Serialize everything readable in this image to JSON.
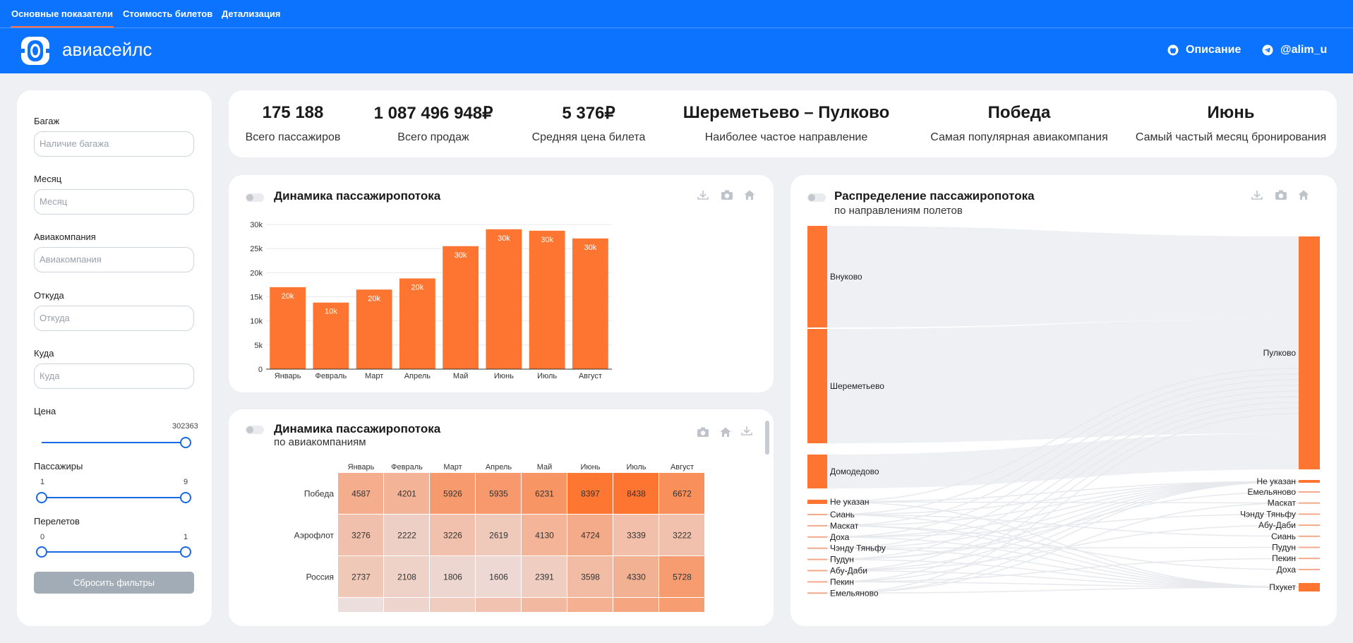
{
  "tabs": [
    "Основные показатели",
    "Стоимость билетов",
    "Детализация"
  ],
  "brand": "авиасейлс",
  "header_links": {
    "description": "Описание",
    "user": "@alim_u"
  },
  "filters": {
    "baggage_label": "Багаж",
    "baggage_placeholder": "Наличие багажа",
    "month_label": "Месяц",
    "month_placeholder": "Месяц",
    "airline_label": "Авиакомпания",
    "airline_placeholder": "Авиакомпания",
    "from_label": "Откуда",
    "from_placeholder": "Откуда",
    "to_label": "Куда",
    "to_placeholder": "Куда",
    "price_label": "Цена",
    "price_max": "302363",
    "passengers_label": "Пассажиры",
    "passengers_min": "1",
    "passengers_max": "9",
    "flights_label": "Перелетов",
    "flights_min": "0",
    "flights_max": "1",
    "reset_label": "Сбросить фильтры"
  },
  "kpis": [
    {
      "value": "175 188",
      "label": "Всего пассажиров"
    },
    {
      "value": "1 087 496 948₽",
      "label": "Всего продаж"
    },
    {
      "value": "5 376₽",
      "label": "Средняя цена билета"
    },
    {
      "value": "Шереметьево – Пулково",
      "label": "Наиболее частое направление"
    },
    {
      "value": "Победа",
      "label": "Самая популярная авиакомпания"
    },
    {
      "value": "Июнь",
      "label": "Самый частый месяц бронирования"
    }
  ],
  "bar_card": {
    "title": "Динамика пассажиропотока"
  },
  "heat_card": {
    "title": "Динамика пассажиропотока",
    "subtitle": "по авиакомпаниям"
  },
  "sankey_card": {
    "title": "Распределение пассажиропотока",
    "subtitle": "по направлениям полетов"
  },
  "chart_data": [
    {
      "type": "bar",
      "categories": [
        "Январь",
        "Февраль",
        "Март",
        "Апрель",
        "Май",
        "Июнь",
        "Июль",
        "Август"
      ],
      "values": [
        17000,
        13800,
        16500,
        18800,
        25500,
        29000,
        28700,
        27100
      ],
      "data_labels": [
        "20k",
        "10k",
        "20k",
        "20k",
        "30k",
        "30k",
        "30k",
        "30k"
      ],
      "y_ticks": [
        "0",
        "5k",
        "10k",
        "15k",
        "20k",
        "25k",
        "30k"
      ],
      "ylim": [
        0,
        30000
      ],
      "color": "#fd7531"
    },
    {
      "type": "heatmap",
      "columns": [
        "Январь",
        "Февраль",
        "Март",
        "Апрель",
        "Май",
        "Июнь",
        "Июль",
        "Август"
      ],
      "rows": [
        "Победа",
        "Аэрофлот",
        "Россия"
      ],
      "values": [
        [
          4587,
          4201,
          5926,
          5935,
          6231,
          8397,
          8438,
          6672
        ],
        [
          3276,
          2222,
          3226,
          2619,
          4130,
          4724,
          3339,
          3222
        ],
        [
          2737,
          2108,
          1806,
          1606,
          2391,
          3598,
          4330,
          5728
        ]
      ],
      "scale": [
        "#eaeaf0",
        "#fd7531"
      ]
    },
    {
      "type": "sankey",
      "sources": [
        "Внуково",
        "Шереметьево",
        "Домодедово",
        "Не указан",
        "Сиань",
        "Маскат",
        "Доха",
        "Чэнду Тяньфу",
        "Пудун",
        "Абу-Даби",
        "Пекин",
        "Емельяново"
      ],
      "targets": [
        "Пулково",
        "Не указан",
        "Емельяново",
        "Маскат",
        "Чэнду Тяньфу",
        "Абу-Даби",
        "Сиань",
        "Пудун",
        "Пекин",
        "Доха",
        "Пхукет"
      ],
      "color": "#fd7531"
    }
  ]
}
